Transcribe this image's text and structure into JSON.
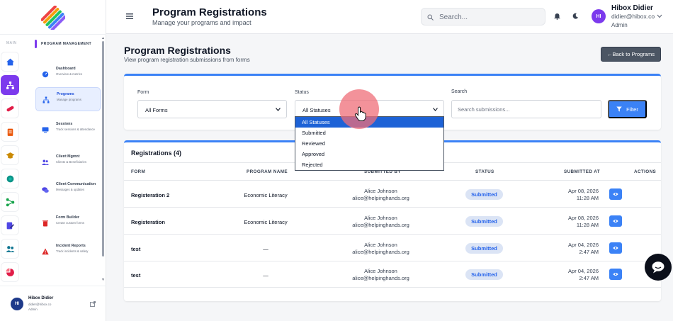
{
  "sidebar": {
    "main_label": "MAIN",
    "section_label": "PROGRAM MANAGEMENT",
    "items": [
      {
        "title": "Dashboard",
        "sub": "Overview & metrics"
      },
      {
        "title": "Programs",
        "sub": "Manage programs"
      },
      {
        "title": "Sessions",
        "sub": "Track sessions & attendance"
      },
      {
        "title": "Client Mgmnt",
        "sub": "Clients & Beneficiaries"
      },
      {
        "title": "Client Communication",
        "sub": "Messages & updates"
      },
      {
        "title": "Form Builder",
        "sub": "Create custom forms"
      },
      {
        "title": "Incident Reports",
        "sub": "Track incidents & safety"
      }
    ],
    "user": {
      "initials": "HI",
      "name": "Hibox Didier",
      "email": "didier@hibox.co",
      "role": "Admin"
    }
  },
  "header": {
    "title": "Program Registrations",
    "subtitle": "Manage your programs and impact",
    "search_placeholder": "Search...",
    "user": {
      "initials": "HI",
      "name": "Hibox Didier",
      "email": "didier@hibox.co",
      "role": "Admin"
    }
  },
  "page": {
    "title": "Program Registrations",
    "subtitle": "View program registration submissions from forms",
    "back_button": "←Back to Programs"
  },
  "filters": {
    "form_label": "Form",
    "form_value": "All Forms",
    "status_label": "Status",
    "status_value": "All Statuses",
    "search_label": "Search",
    "search_placeholder": "Search submissions...",
    "filter_button": "Filter",
    "status_options": [
      "All Statuses",
      "Submitted",
      "Reviewed",
      "Approved",
      "Rejected"
    ]
  },
  "table": {
    "heading": "Registrations (4)",
    "columns": [
      "FORM",
      "PROGRAM NAME",
      "SUBMITTED BY",
      "STATUS",
      "SUBMITTED AT",
      "ACTIONS"
    ],
    "rows": [
      {
        "form": "Registeration 2",
        "program": "Economic Literacy",
        "by_name": "Alice Johnson",
        "by_email": "alice@helpinghands.org",
        "status": "Submitted",
        "date": "Apr 08, 2026",
        "time": "11:28 AM"
      },
      {
        "form": "Registeration",
        "program": "Economic Literacy",
        "by_name": "Alice Johnson",
        "by_email": "alice@helpinghands.org",
        "status": "Submitted",
        "date": "Apr 08, 2026",
        "time": "11:28 AM"
      },
      {
        "form": "test",
        "program": "—",
        "by_name": "Alice Johnson",
        "by_email": "alice@helpinghands.org",
        "status": "Submitted",
        "date": "Apr 04, 2026",
        "time": "2:47 AM"
      },
      {
        "form": "test",
        "program": "—",
        "by_name": "Alice Johnson",
        "by_email": "alice@helpinghands.org",
        "status": "Submitted",
        "date": "Apr 04, 2026",
        "time": "2:47 AM"
      }
    ]
  },
  "icons": {
    "menu": "hamburger-icon",
    "search": "search-icon",
    "bell": "bell-icon",
    "theme": "moon-icon",
    "chevron": "chevron-down-icon",
    "filter": "funnel-icon",
    "view": "eye-icon",
    "chat": "chat-icon",
    "external": "external-link-icon"
  },
  "colors": {
    "primary": "#3b82f6",
    "accent": "#7c3aed",
    "dropdown_selected": "#1d62d6",
    "status_badge_bg": "#dbe4f5",
    "status_badge_text": "#2563eb"
  }
}
